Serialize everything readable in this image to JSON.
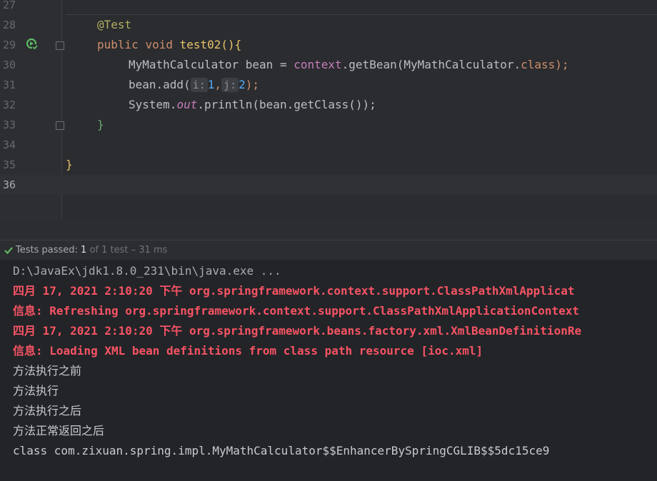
{
  "editor": {
    "lines": [
      {
        "num": "27"
      },
      {
        "num": "28",
        "annotation": "@Test"
      },
      {
        "num": "29",
        "kw_public": "public",
        "kw_void": "void",
        "method": "test02",
        "open": "(){"
      },
      {
        "num": "30",
        "type": "MyMathCalculator",
        "var": "bean",
        "eq": "=",
        "ctx": "context",
        "call": ".getBean(",
        "arg": "MyMathCalculator.",
        "cls": "class",
        "end": ");"
      },
      {
        "num": "31",
        "obj": "bean.add(",
        "hint_i": "i:",
        "val_i": "1",
        "comma": ",",
        "hint_j": "j:",
        "val_j": "2",
        "end": ");"
      },
      {
        "num": "32",
        "sys": "System.",
        "out": "out",
        "println": ".println(bean.getClass());"
      },
      {
        "num": "33",
        "brace": "}"
      },
      {
        "num": "34"
      },
      {
        "num": "35",
        "brace": "}"
      },
      {
        "num": "36"
      }
    ]
  },
  "status": {
    "label": "Tests passed:",
    "passed": "1",
    "rest": "of 1 test – 31 ms"
  },
  "console": {
    "lines": [
      "D:\\JavaEx\\jdk1.8.0_231\\bin\\java.exe ...",
      "四月 17, 2021 2:10:20 下午 org.springframework.context.support.ClassPathXmlApplicat",
      "信息: Refreshing org.springframework.context.support.ClassPathXmlApplicationContext",
      "四月 17, 2021 2:10:20 下午 org.springframework.beans.factory.xml.XmlBeanDefinitionRe",
      "信息: Loading XML bean definitions from class path resource [ioc.xml]",
      "方法执行之前",
      "方法执行",
      "方法执行之后",
      "方法正常返回之后",
      "class com.zixuan.spring.impl.MyMathCalculator$$EnhancerBySpringCGLIB$$5dc15ce9"
    ]
  },
  "colors": {
    "annotation": "#b3ae60",
    "keyword": "#cf8e6d",
    "method": "#e8c46a",
    "field": "#c77dbb",
    "number": "#56a8f5",
    "error_red": "#f75464",
    "pass_green": "#5fb865"
  },
  "icons": {
    "run": "run-test-icon",
    "pass": "check-icon",
    "fold": "fold-marker-icon"
  }
}
